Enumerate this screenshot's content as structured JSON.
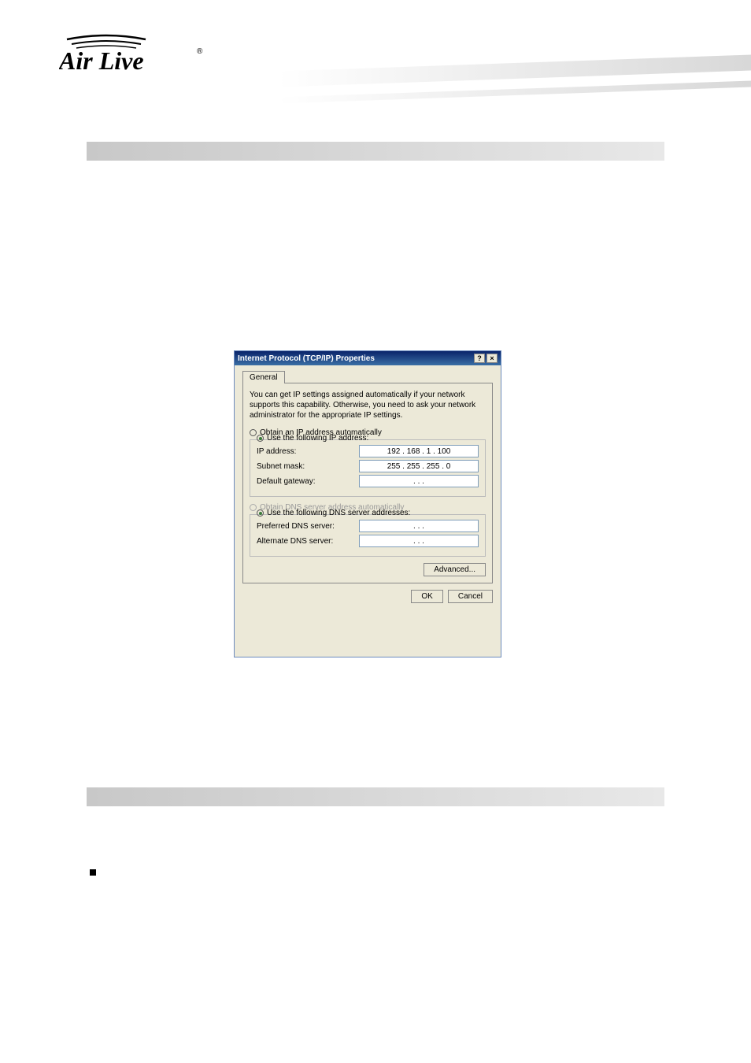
{
  "logo": {
    "brand_text": "Air Live",
    "registered_mark": "®"
  },
  "dialog": {
    "title": "Internet Protocol (TCP/IP) Properties",
    "help_glyph": "?",
    "close_glyph": "×",
    "tab_label": "General",
    "info_text": "You can get IP settings assigned automatically if your network supports this capability. Otherwise, you need to ask your network administrator for the appropriate IP settings.",
    "radio_obtain_ip": "Obtain an IP address automatically",
    "radio_use_ip": "Use the following IP address:",
    "field_ip_label": "IP address:",
    "field_ip_value": "192 . 168 .   1 . 100",
    "field_subnet_label": "Subnet mask:",
    "field_subnet_value": "255 . 255 . 255 .   0",
    "field_gateway_label": "Default gateway:",
    "field_gateway_value": ".       .       .",
    "radio_obtain_dns": "Obtain DNS server address automatically",
    "radio_use_dns": "Use the following DNS server addresses:",
    "field_pref_dns_label": "Preferred DNS server:",
    "field_pref_dns_value": ".       .       .",
    "field_alt_dns_label": "Alternate DNS server:",
    "field_alt_dns_value": ".       .       .",
    "advanced_label": "Advanced...",
    "ok_label": "OK",
    "cancel_label": "Cancel"
  }
}
